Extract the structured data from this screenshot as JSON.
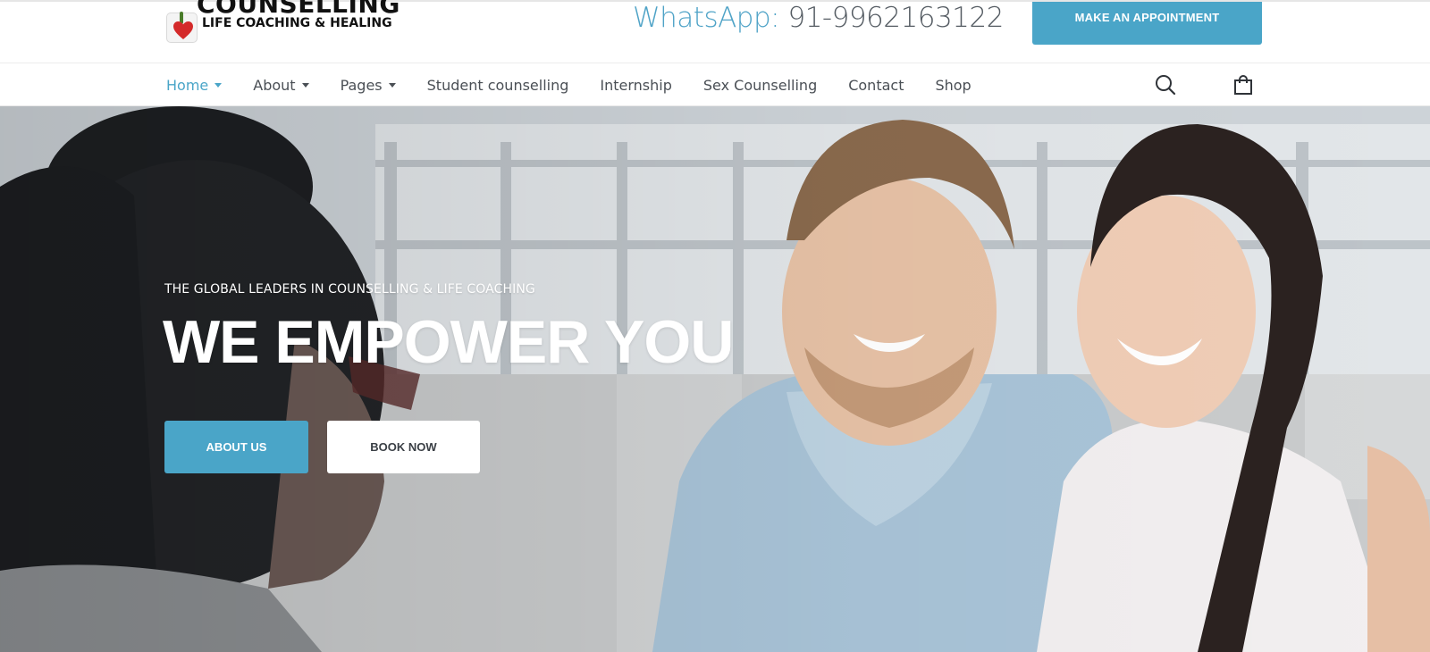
{
  "header": {
    "logo": {
      "title": "COUNSELLING",
      "subtitle": "LIFE COACHING & HEALING"
    },
    "whatsapp_label": "WhatsApp:",
    "whatsapp_number": "91-9962163122",
    "appointment_button": "MAKE AN APPOINTMENT"
  },
  "nav": {
    "items": [
      {
        "label": "Home",
        "dropdown": true,
        "active": true
      },
      {
        "label": "About",
        "dropdown": true,
        "active": false
      },
      {
        "label": "Pages",
        "dropdown": true,
        "active": false
      },
      {
        "label": "Student counselling",
        "dropdown": false,
        "active": false
      },
      {
        "label": "Internship",
        "dropdown": false,
        "active": false
      },
      {
        "label": "Sex Counselling",
        "dropdown": false,
        "active": false
      },
      {
        "label": "Contact",
        "dropdown": false,
        "active": false
      },
      {
        "label": "Shop",
        "dropdown": false,
        "active": false
      }
    ],
    "icons": [
      "search-icon",
      "shopping-bag-icon"
    ]
  },
  "hero": {
    "tagline": "THE GLOBAL LEADERS IN COUNSELLING & LIFE COACHING",
    "title": "WE EMPOWER YOU",
    "about_button": "ABOUT US",
    "book_button": "BOOK NOW"
  },
  "colors": {
    "accent": "#4aa5c8",
    "text_dark": "#4a4f55",
    "white": "#ffffff"
  }
}
